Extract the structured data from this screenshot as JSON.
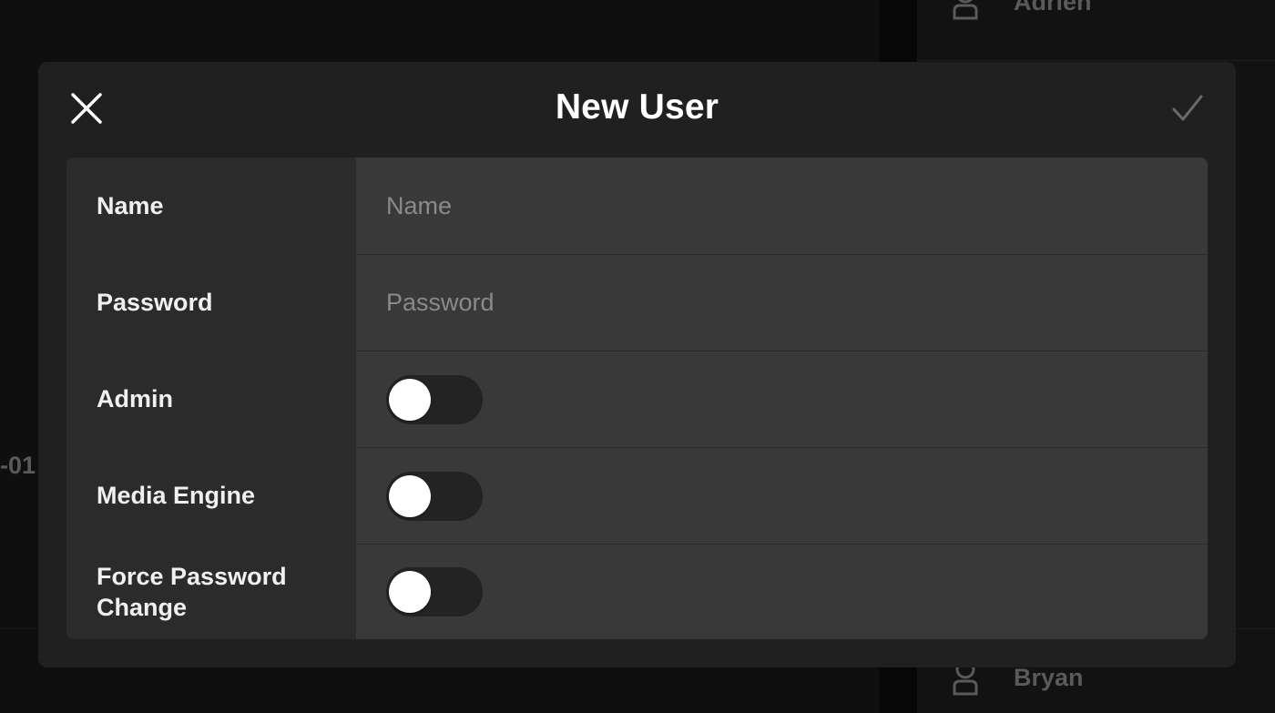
{
  "background": {
    "users": [
      {
        "name": "Adrien"
      },
      {
        "name": "Bryan"
      }
    ],
    "left_fragment": "-01"
  },
  "modal": {
    "title": "New User",
    "close_icon": "close-icon",
    "confirm_icon": "checkmark-icon",
    "fields": {
      "name": {
        "label": "Name",
        "placeholder": "Name",
        "value": ""
      },
      "password": {
        "label": "Password",
        "placeholder": "Password",
        "value": ""
      },
      "admin": {
        "label": "Admin",
        "enabled": false
      },
      "media_engine": {
        "label": "Media Engine",
        "enabled": false
      },
      "force_password_change": {
        "label": "Force Password Change",
        "enabled": false
      }
    }
  },
  "colors": {
    "modal_background": "#202020",
    "label_column": "#2b2b2b",
    "value_column": "#393939",
    "toggle_track_off": "#232323",
    "toggle_knob": "#ffffff"
  }
}
